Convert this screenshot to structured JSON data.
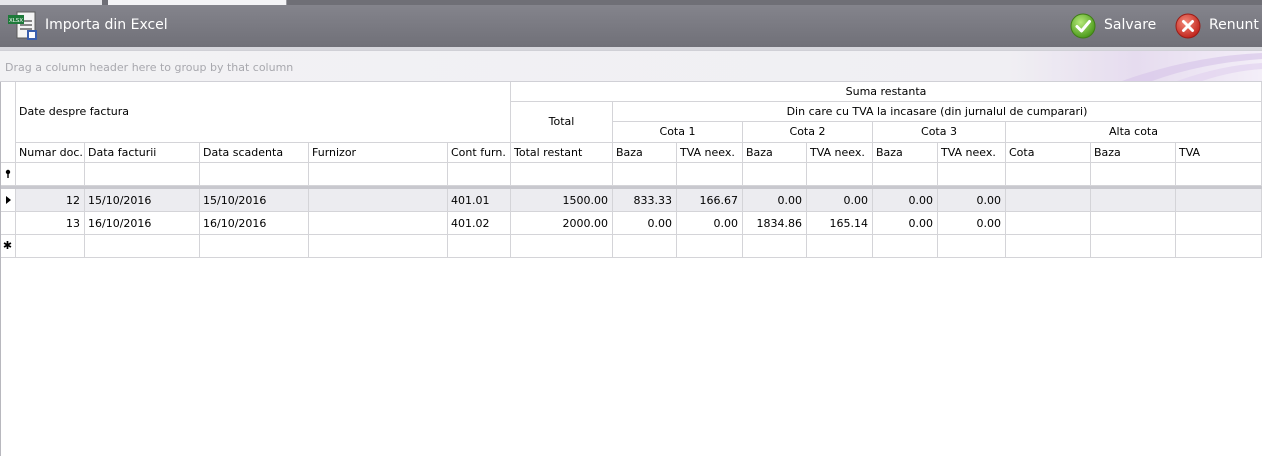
{
  "window": {
    "title": "Importa din Excel",
    "icon": "excel-import-icon",
    "icon_badge": "XLSX"
  },
  "toolbar": {
    "save_label": "Salvare",
    "cancel_label": "Renunt",
    "save_icon": "check-icon",
    "cancel_icon": "close-icon",
    "save_color": "#6cbf2c",
    "cancel_color": "#d9342a"
  },
  "group_panel": {
    "placeholder": "Drag a column header here to group by that column"
  },
  "grid": {
    "band_date_despre": "Date despre factura",
    "band_suma_restanta": "Suma restanta",
    "band_total": "Total",
    "band_din_care": "Din care cu TVA la incasare (din jurnalul de cumparari)",
    "band_cota1": "Cota 1",
    "band_cota2": "Cota 2",
    "band_cota3": "Cota 3",
    "band_alta_cota": "Alta cota",
    "columns": [
      "Numar doc.",
      "Data facturii",
      "Data scadenta",
      "Furnizor",
      "Cont furn.",
      "Total restant",
      "Baza",
      "TVA neex.",
      "Baza",
      "TVA neex.",
      "Baza",
      "TVA neex.",
      "Cota",
      "Baza",
      "TVA"
    ],
    "rows": [
      [
        "12",
        "15/10/2016",
        "15/10/2016",
        "",
        "401.01",
        "1500.00",
        "833.33",
        "166.67",
        "0.00",
        "0.00",
        "0.00",
        "0.00",
        "",
        "",
        ""
      ],
      [
        "13",
        "16/10/2016",
        "16/10/2016",
        "",
        "401.02",
        "2000.00",
        "0.00",
        "0.00",
        "1834.86",
        "165.14",
        "0.00",
        "0.00",
        "",
        "",
        ""
      ]
    ],
    "filter_row_icon": "filter-icon",
    "new_row_icon": "new-row-asterisk-icon",
    "current_row_icon": "current-row-arrow-icon"
  }
}
